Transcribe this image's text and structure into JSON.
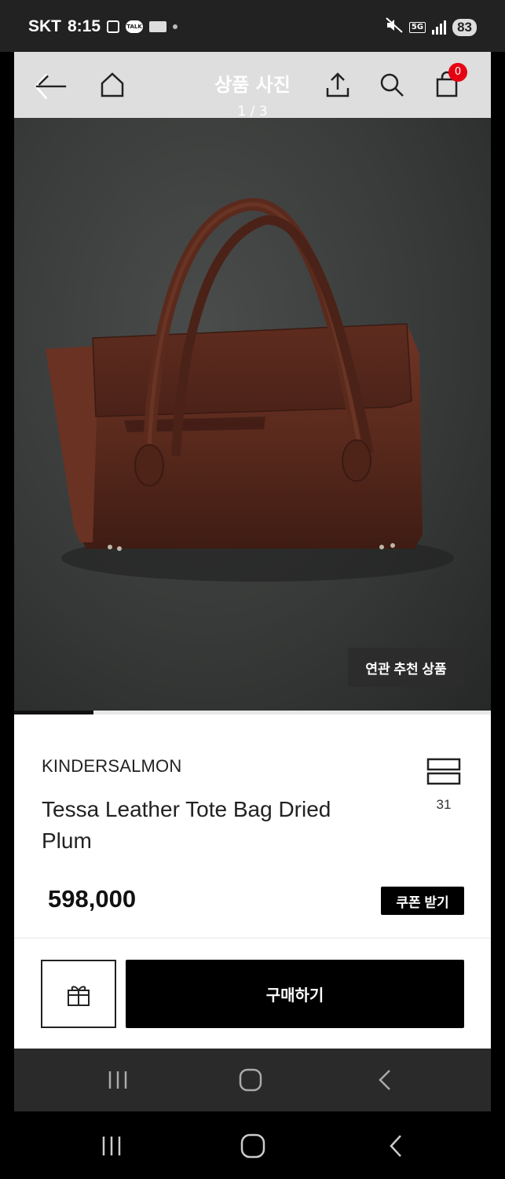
{
  "status_bar": {
    "carrier": "SKT",
    "time": "8:15",
    "network": "5G",
    "battery": "83"
  },
  "header": {
    "title": "상품 사진",
    "counter": "1 / 3",
    "cart_count": "0"
  },
  "gallery": {
    "related_button": "연관 추천 상품",
    "current_image": 1,
    "total_images": 3
  },
  "product": {
    "brand": "KINDERSALMON",
    "name": "Tessa Leather Tote Bag Dried Plum",
    "review_count": "31",
    "price": "598,000",
    "coupon_button": "쿠폰 받기"
  },
  "actions": {
    "buy_button": "구매하기"
  },
  "colors": {
    "accent_badge": "#e60012",
    "primary_button": "#000000"
  }
}
